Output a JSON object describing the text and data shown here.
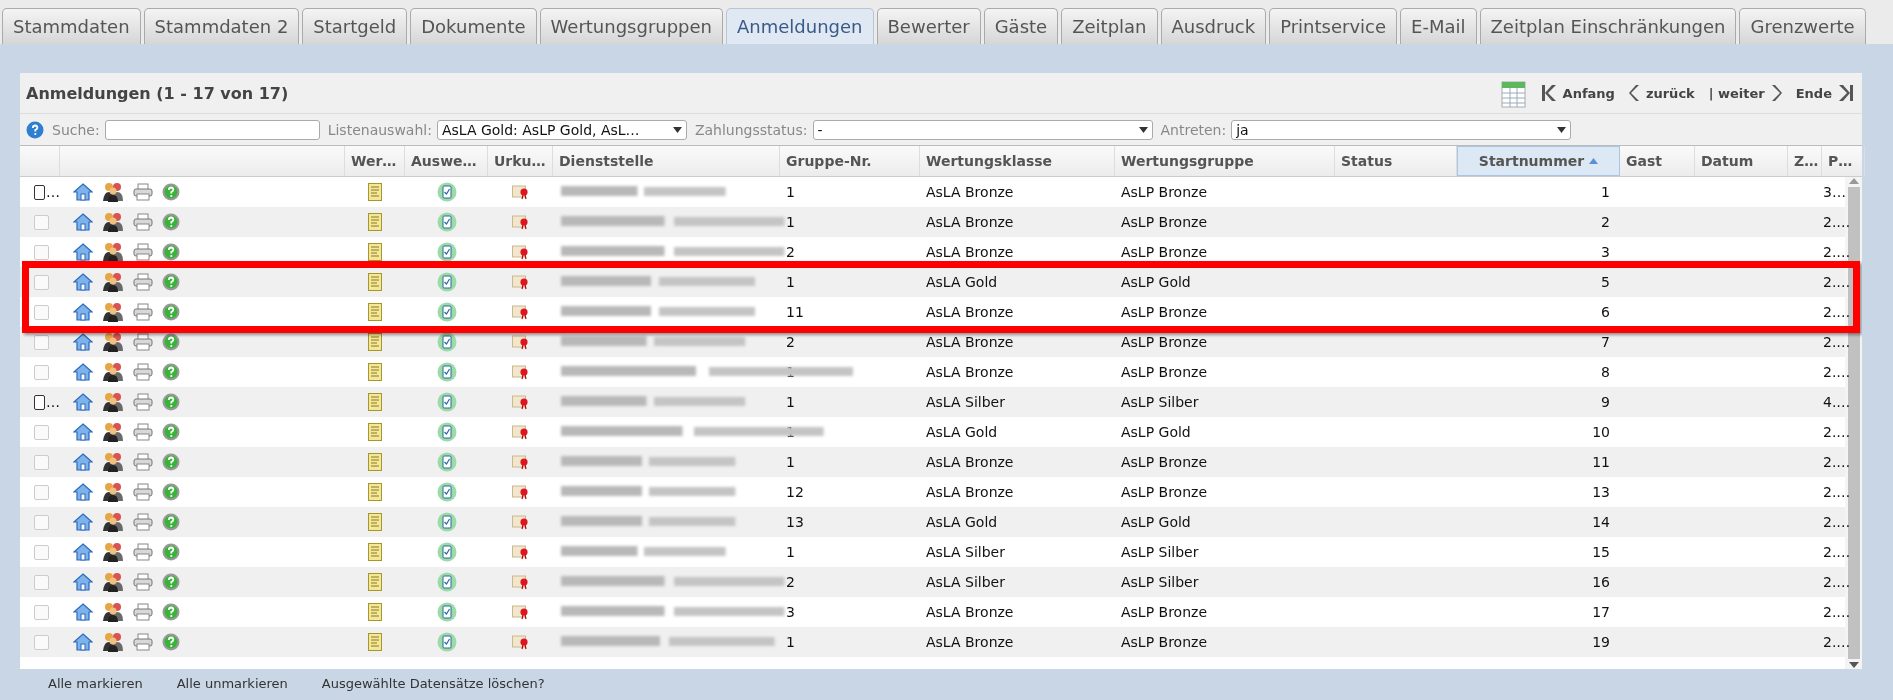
{
  "tabs": [
    {
      "label": "Stammdaten",
      "selected": false
    },
    {
      "label": "Stammdaten 2",
      "selected": false
    },
    {
      "label": "Startgeld",
      "selected": false
    },
    {
      "label": "Dokumente",
      "selected": false
    },
    {
      "label": "Wertungsgruppen",
      "selected": false
    },
    {
      "label": "Anmeldungen",
      "selected": true
    },
    {
      "label": "Bewerter",
      "selected": false
    },
    {
      "label": "Gäste",
      "selected": false
    },
    {
      "label": "Zeitplan",
      "selected": false
    },
    {
      "label": "Ausdruck",
      "selected": false
    },
    {
      "label": "Printservice",
      "selected": false
    },
    {
      "label": "E-Mail",
      "selected": false
    },
    {
      "label": "Zeitplan Einschränkungen",
      "selected": false
    },
    {
      "label": "Grenzwerte",
      "selected": false
    }
  ],
  "panel": {
    "title": "Anmeldungen (1 - 17 von 17)",
    "pager": [
      {
        "kind": "first",
        "label": "Anfang"
      },
      {
        "kind": "prev",
        "label": "zurück"
      },
      {
        "kind": "next",
        "label": "| weiter"
      },
      {
        "kind": "last",
        "label": "Ende"
      }
    ],
    "filters": [
      {
        "label": "Suche:",
        "kind": "text"
      },
      {
        "label": "Listenauswahl:",
        "kind": "select",
        "value": "AsLA Gold: AsLP Gold, AsL…"
      },
      {
        "label": "Zahlungsstatus:",
        "kind": "select",
        "value": "-"
      },
      {
        "label": "Antreten:",
        "kind": "select",
        "value": "ja"
      }
    ]
  },
  "table": {
    "columns": [
      {
        "label": "Wer…"
      },
      {
        "label": "Auswe…"
      },
      {
        "label": "Urku…"
      },
      {
        "label": "Dienststelle"
      },
      {
        "label": "Gruppe-Nr."
      },
      {
        "label": "Wertungsklasse"
      },
      {
        "label": "Wertungsgruppe"
      },
      {
        "label": "Status"
      },
      {
        "label": "Startnummer",
        "sorted": true
      },
      {
        "label": "Gast"
      },
      {
        "label": "Datum"
      },
      {
        "label": "Z…"
      },
      {
        "label": "P…"
      }
    ],
    "rows": [
      {
        "checked": false,
        "disabled": false,
        "mark": "…",
        "gruppe": "1",
        "klasse": "AsLA Bronze",
        "wertungsgruppe": "AsLP Bronze",
        "start": "1",
        "p": "3…",
        "highlighted": false
      },
      {
        "checked": false,
        "disabled": true,
        "gruppe": "1",
        "klasse": "AsLA Bronze",
        "wertungsgruppe": "AsLP Bronze",
        "start": "2",
        "p": "2.…",
        "highlighted": false
      },
      {
        "checked": false,
        "disabled": true,
        "gruppe": "2",
        "klasse": "AsLA Bronze",
        "wertungsgruppe": "AsLP Bronze",
        "start": "3",
        "p": "2.…",
        "highlighted": false
      },
      {
        "checked": false,
        "disabled": true,
        "gruppe": "1",
        "klasse": "AsLA Gold",
        "wertungsgruppe": "AsLP Gold",
        "start": "5",
        "p": "2.…",
        "highlighted": true
      },
      {
        "checked": false,
        "disabled": true,
        "gruppe": "11",
        "klasse": "AsLA Bronze",
        "wertungsgruppe": "AsLP Bronze",
        "start": "6",
        "p": "2.…",
        "highlighted": true
      },
      {
        "checked": false,
        "disabled": true,
        "gruppe": "2",
        "klasse": "AsLA Bronze",
        "wertungsgruppe": "AsLP Bronze",
        "start": "7",
        "p": "2.…",
        "highlighted": false
      },
      {
        "checked": false,
        "disabled": true,
        "gruppe": "1",
        "klasse": "AsLA Bronze",
        "wertungsgruppe": "AsLP Bronze",
        "start": "8",
        "p": "2.…",
        "highlighted": false
      },
      {
        "checked": false,
        "disabled": false,
        "mark": "…",
        "gruppe": "1",
        "klasse": "AsLA Silber",
        "wertungsgruppe": "AsLP Silber",
        "start": "9",
        "p": "4.…",
        "highlighted": false
      },
      {
        "checked": false,
        "disabled": true,
        "gruppe": "1",
        "klasse": "AsLA Gold",
        "wertungsgruppe": "AsLP Gold",
        "start": "10",
        "p": "2.…",
        "highlighted": false
      },
      {
        "checked": false,
        "disabled": true,
        "gruppe": "1",
        "klasse": "AsLA Bronze",
        "wertungsgruppe": "AsLP Bronze",
        "start": "11",
        "p": "2.…",
        "highlighted": false
      },
      {
        "checked": false,
        "disabled": true,
        "gruppe": "12",
        "klasse": "AsLA Bronze",
        "wertungsgruppe": "AsLP Bronze",
        "start": "13",
        "p": "2.…",
        "highlighted": false
      },
      {
        "checked": false,
        "disabled": true,
        "gruppe": "13",
        "klasse": "AsLA Gold",
        "wertungsgruppe": "AsLP Gold",
        "start": "14",
        "p": "2.…",
        "highlighted": false
      },
      {
        "checked": false,
        "disabled": true,
        "gruppe": "1",
        "klasse": "AsLA Silber",
        "wertungsgruppe": "AsLP Silber",
        "start": "15",
        "p": "2.…",
        "highlighted": false
      },
      {
        "checked": false,
        "disabled": true,
        "gruppe": "2",
        "klasse": "AsLA Silber",
        "wertungsgruppe": "AsLP Silber",
        "start": "16",
        "p": "2.…",
        "highlighted": false
      },
      {
        "checked": false,
        "disabled": true,
        "gruppe": "3",
        "klasse": "AsLA Bronze",
        "wertungsgruppe": "AsLP Bronze",
        "start": "17",
        "p": "2.…",
        "highlighted": false
      },
      {
        "checked": false,
        "disabled": true,
        "gruppe": "1",
        "klasse": "AsLA Bronze",
        "wertungsgruppe": "AsLP Bronze",
        "start": "19",
        "p": "2.…",
        "highlighted": false
      }
    ]
  },
  "footer_links": [
    "Alle markieren",
    "Alle unmarkieren",
    "Ausgewählte Datensätze löschen?"
  ]
}
